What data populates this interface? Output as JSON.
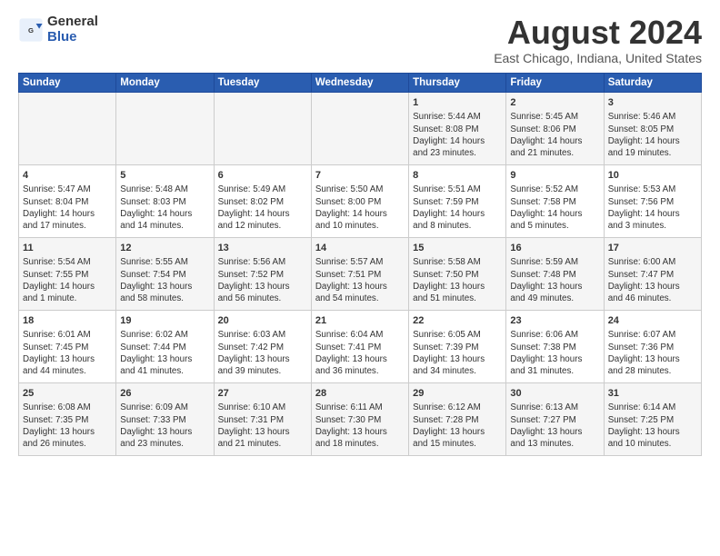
{
  "logo": {
    "general": "General",
    "blue": "Blue"
  },
  "title": "August 2024",
  "subtitle": "East Chicago, Indiana, United States",
  "headers": [
    "Sunday",
    "Monday",
    "Tuesday",
    "Wednesday",
    "Thursday",
    "Friday",
    "Saturday"
  ],
  "weeks": [
    [
      {
        "date": "",
        "info": ""
      },
      {
        "date": "",
        "info": ""
      },
      {
        "date": "",
        "info": ""
      },
      {
        "date": "",
        "info": ""
      },
      {
        "date": "1",
        "info": "Sunrise: 5:44 AM\nSunset: 8:08 PM\nDaylight: 14 hours\nand 23 minutes."
      },
      {
        "date": "2",
        "info": "Sunrise: 5:45 AM\nSunset: 8:06 PM\nDaylight: 14 hours\nand 21 minutes."
      },
      {
        "date": "3",
        "info": "Sunrise: 5:46 AM\nSunset: 8:05 PM\nDaylight: 14 hours\nand 19 minutes."
      }
    ],
    [
      {
        "date": "4",
        "info": "Sunrise: 5:47 AM\nSunset: 8:04 PM\nDaylight: 14 hours\nand 17 minutes."
      },
      {
        "date": "5",
        "info": "Sunrise: 5:48 AM\nSunset: 8:03 PM\nDaylight: 14 hours\nand 14 minutes."
      },
      {
        "date": "6",
        "info": "Sunrise: 5:49 AM\nSunset: 8:02 PM\nDaylight: 14 hours\nand 12 minutes."
      },
      {
        "date": "7",
        "info": "Sunrise: 5:50 AM\nSunset: 8:00 PM\nDaylight: 14 hours\nand 10 minutes."
      },
      {
        "date": "8",
        "info": "Sunrise: 5:51 AM\nSunset: 7:59 PM\nDaylight: 14 hours\nand 8 minutes."
      },
      {
        "date": "9",
        "info": "Sunrise: 5:52 AM\nSunset: 7:58 PM\nDaylight: 14 hours\nand 5 minutes."
      },
      {
        "date": "10",
        "info": "Sunrise: 5:53 AM\nSunset: 7:56 PM\nDaylight: 14 hours\nand 3 minutes."
      }
    ],
    [
      {
        "date": "11",
        "info": "Sunrise: 5:54 AM\nSunset: 7:55 PM\nDaylight: 14 hours\nand 1 minute."
      },
      {
        "date": "12",
        "info": "Sunrise: 5:55 AM\nSunset: 7:54 PM\nDaylight: 13 hours\nand 58 minutes."
      },
      {
        "date": "13",
        "info": "Sunrise: 5:56 AM\nSunset: 7:52 PM\nDaylight: 13 hours\nand 56 minutes."
      },
      {
        "date": "14",
        "info": "Sunrise: 5:57 AM\nSunset: 7:51 PM\nDaylight: 13 hours\nand 54 minutes."
      },
      {
        "date": "15",
        "info": "Sunrise: 5:58 AM\nSunset: 7:50 PM\nDaylight: 13 hours\nand 51 minutes."
      },
      {
        "date": "16",
        "info": "Sunrise: 5:59 AM\nSunset: 7:48 PM\nDaylight: 13 hours\nand 49 minutes."
      },
      {
        "date": "17",
        "info": "Sunrise: 6:00 AM\nSunset: 7:47 PM\nDaylight: 13 hours\nand 46 minutes."
      }
    ],
    [
      {
        "date": "18",
        "info": "Sunrise: 6:01 AM\nSunset: 7:45 PM\nDaylight: 13 hours\nand 44 minutes."
      },
      {
        "date": "19",
        "info": "Sunrise: 6:02 AM\nSunset: 7:44 PM\nDaylight: 13 hours\nand 41 minutes."
      },
      {
        "date": "20",
        "info": "Sunrise: 6:03 AM\nSunset: 7:42 PM\nDaylight: 13 hours\nand 39 minutes."
      },
      {
        "date": "21",
        "info": "Sunrise: 6:04 AM\nSunset: 7:41 PM\nDaylight: 13 hours\nand 36 minutes."
      },
      {
        "date": "22",
        "info": "Sunrise: 6:05 AM\nSunset: 7:39 PM\nDaylight: 13 hours\nand 34 minutes."
      },
      {
        "date": "23",
        "info": "Sunrise: 6:06 AM\nSunset: 7:38 PM\nDaylight: 13 hours\nand 31 minutes."
      },
      {
        "date": "24",
        "info": "Sunrise: 6:07 AM\nSunset: 7:36 PM\nDaylight: 13 hours\nand 28 minutes."
      }
    ],
    [
      {
        "date": "25",
        "info": "Sunrise: 6:08 AM\nSunset: 7:35 PM\nDaylight: 13 hours\nand 26 minutes."
      },
      {
        "date": "26",
        "info": "Sunrise: 6:09 AM\nSunset: 7:33 PM\nDaylight: 13 hours\nand 23 minutes."
      },
      {
        "date": "27",
        "info": "Sunrise: 6:10 AM\nSunset: 7:31 PM\nDaylight: 13 hours\nand 21 minutes."
      },
      {
        "date": "28",
        "info": "Sunrise: 6:11 AM\nSunset: 7:30 PM\nDaylight: 13 hours\nand 18 minutes."
      },
      {
        "date": "29",
        "info": "Sunrise: 6:12 AM\nSunset: 7:28 PM\nDaylight: 13 hours\nand 15 minutes."
      },
      {
        "date": "30",
        "info": "Sunrise: 6:13 AM\nSunset: 7:27 PM\nDaylight: 13 hours\nand 13 minutes."
      },
      {
        "date": "31",
        "info": "Sunrise: 6:14 AM\nSunset: 7:25 PM\nDaylight: 13 hours\nand 10 minutes."
      }
    ]
  ]
}
